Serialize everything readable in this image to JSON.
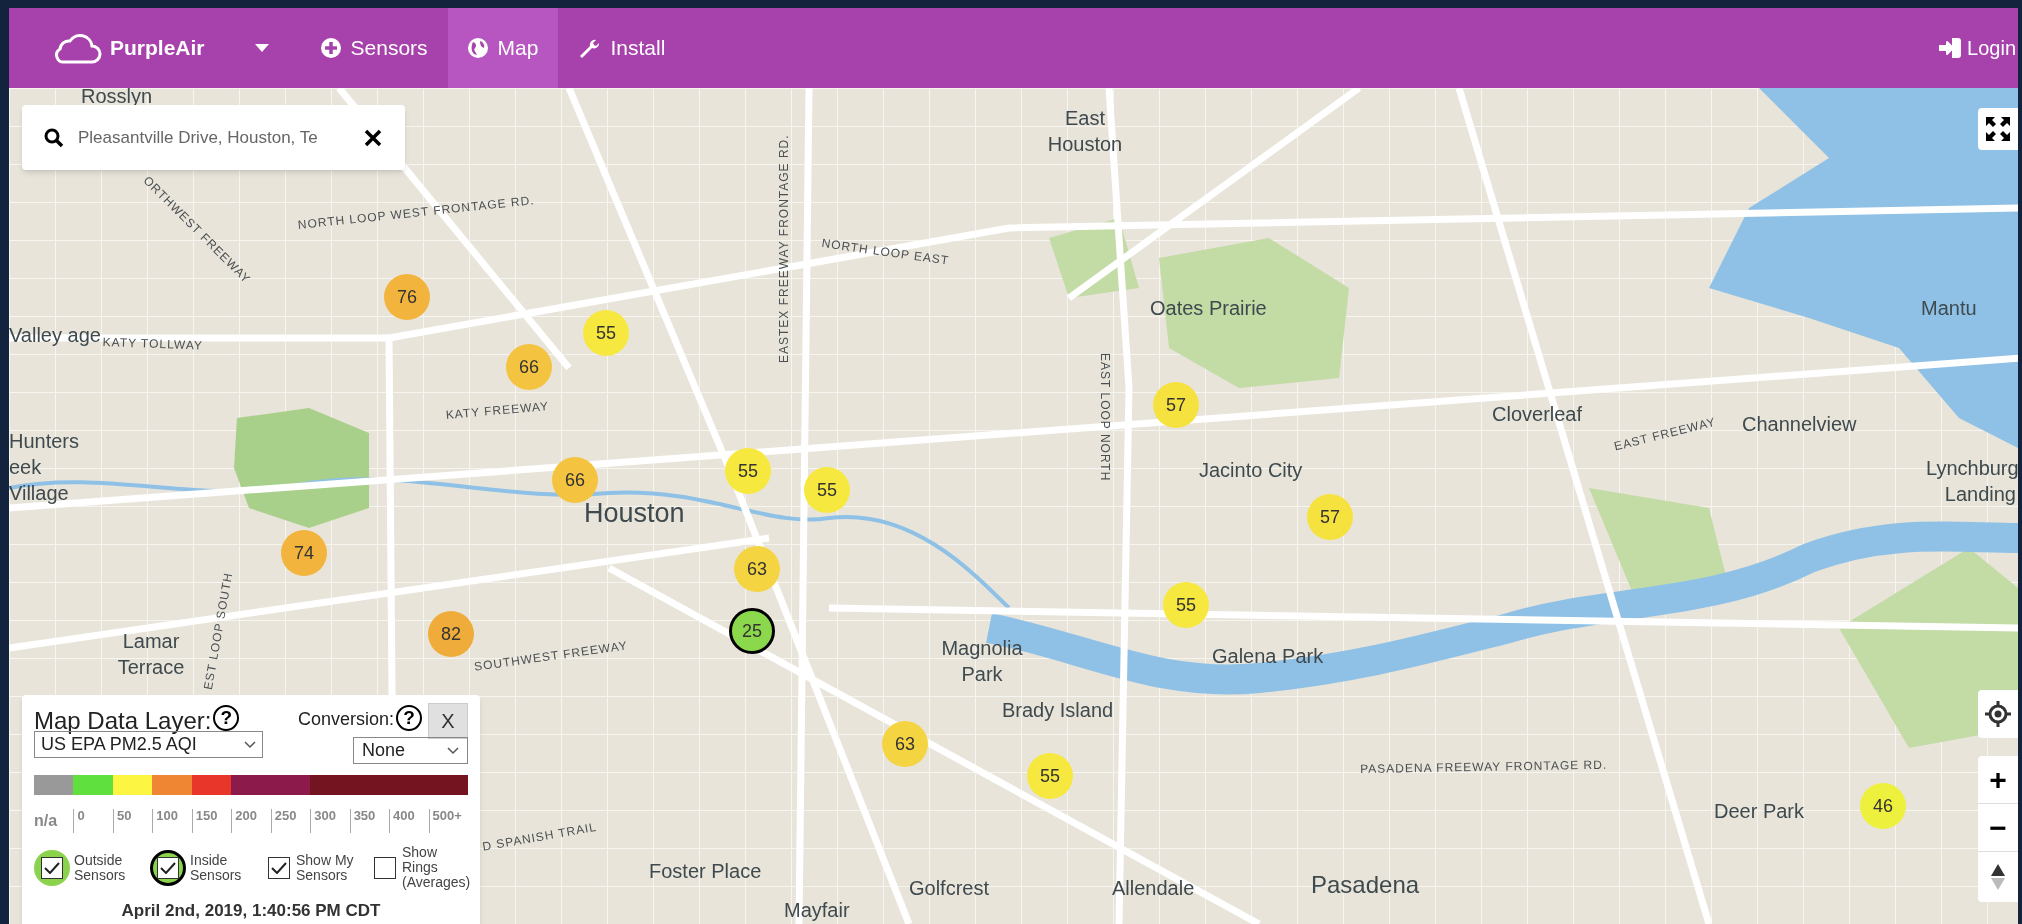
{
  "nav": {
    "brand": "PurpleAir",
    "items": [
      {
        "label": "Sensors",
        "kind": "plus",
        "selected": false
      },
      {
        "label": "Map",
        "kind": "globe",
        "selected": true
      },
      {
        "label": "Install",
        "kind": "wrench",
        "selected": false
      }
    ],
    "login": "Login"
  },
  "search": {
    "value": "Pleasantville Drive, Houston, Te"
  },
  "map": {
    "places": [
      "Rosslyn",
      "East Houston",
      "Valley age",
      "Hunters eek Village",
      "Houston",
      "Oates Prairie",
      "Mantu",
      "Cloverleaf",
      "Channelview",
      "Jacinto City",
      "Lynchburg Landing",
      "Lamar Terrace",
      "Magnolia Park",
      "Galena Park",
      "Brady Island",
      "Deer Park",
      "Foster Place",
      "Mayfair",
      "Golfcrest",
      "Allendale",
      "Pasadena"
    ],
    "roads": [
      "NORTH LOOP WEST FRONTAGE RD.",
      "ORTHWEST FREEWAY",
      "NORTH LOOP EAST",
      "EASTEX FREEWAY FRONTAGE RD.",
      "KATY TOLLWAY",
      "KATY FREEWAY",
      "EAST LOOP NORTH",
      "EAST FREEWAY",
      "SOUTHWEST FREEWAY",
      "EST LOOP SOUTH",
      "PASADENA FREEWAY FRONTAGE RD.",
      "D SPANISH TRAIL"
    ],
    "markers": [
      {
        "value": "76",
        "color": "#f2b43c",
        "kind": "outside"
      },
      {
        "value": "55",
        "color": "#f6e83e",
        "kind": "outside"
      },
      {
        "value": "66",
        "color": "#f4c340",
        "kind": "outside"
      },
      {
        "value": "57",
        "color": "#f6e23e",
        "kind": "outside"
      },
      {
        "value": "55",
        "color": "#f6e83e",
        "kind": "outside"
      },
      {
        "value": "55",
        "color": "#f6e83e",
        "kind": "outside"
      },
      {
        "value": "66",
        "color": "#f4c340",
        "kind": "outside"
      },
      {
        "value": "57",
        "color": "#f6e23e",
        "kind": "outside"
      },
      {
        "value": "74",
        "color": "#f2b43c",
        "kind": "outside"
      },
      {
        "value": "63",
        "color": "#f5d442",
        "kind": "outside"
      },
      {
        "value": "55",
        "color": "#f6e83e",
        "kind": "outside"
      },
      {
        "value": "25",
        "color": "#8cd84c",
        "kind": "inside"
      },
      {
        "value": "82",
        "color": "#f0ac3a",
        "kind": "outside"
      },
      {
        "value": "63",
        "color": "#f5d442",
        "kind": "outside"
      },
      {
        "value": "55",
        "color": "#f6e83e",
        "kind": "outside"
      },
      {
        "value": "46",
        "color": "#eef03e",
        "kind": "outside"
      }
    ]
  },
  "controls": {
    "zoom_in": "+",
    "zoom_out": "−"
  },
  "legend": {
    "title": "Map Data Layer:",
    "help": "?",
    "conversion_label": "Conversion:",
    "conversion_help": "?",
    "close": "X",
    "layer": "US EPA PM2.5 AQI",
    "conversion": "None",
    "scale": [
      {
        "color": "#999999"
      },
      {
        "color": "#5fe03e"
      },
      {
        "color": "#fcf542"
      },
      {
        "color": "#ee8634"
      },
      {
        "color": "#e8362a"
      },
      {
        "color": "#8c1a4b"
      },
      {
        "color": "#731420"
      }
    ],
    "ticks": [
      "n/a",
      "0",
      "50",
      "100",
      "150",
      "200",
      "250",
      "300",
      "350",
      "400",
      "500+"
    ],
    "toggles": [
      {
        "label": "Outside Sensors",
        "kind": "outside",
        "checked": true
      },
      {
        "label": "Inside Sensors",
        "kind": "inside",
        "checked": true
      },
      {
        "label": "Show My Sensors",
        "kind": "plain",
        "checked": true
      },
      {
        "label": "Show Rings (Averages)",
        "kind": "plain",
        "checked": false
      }
    ],
    "timestamp": "April 2nd, 2019, 1:40:56 PM CDT"
  }
}
